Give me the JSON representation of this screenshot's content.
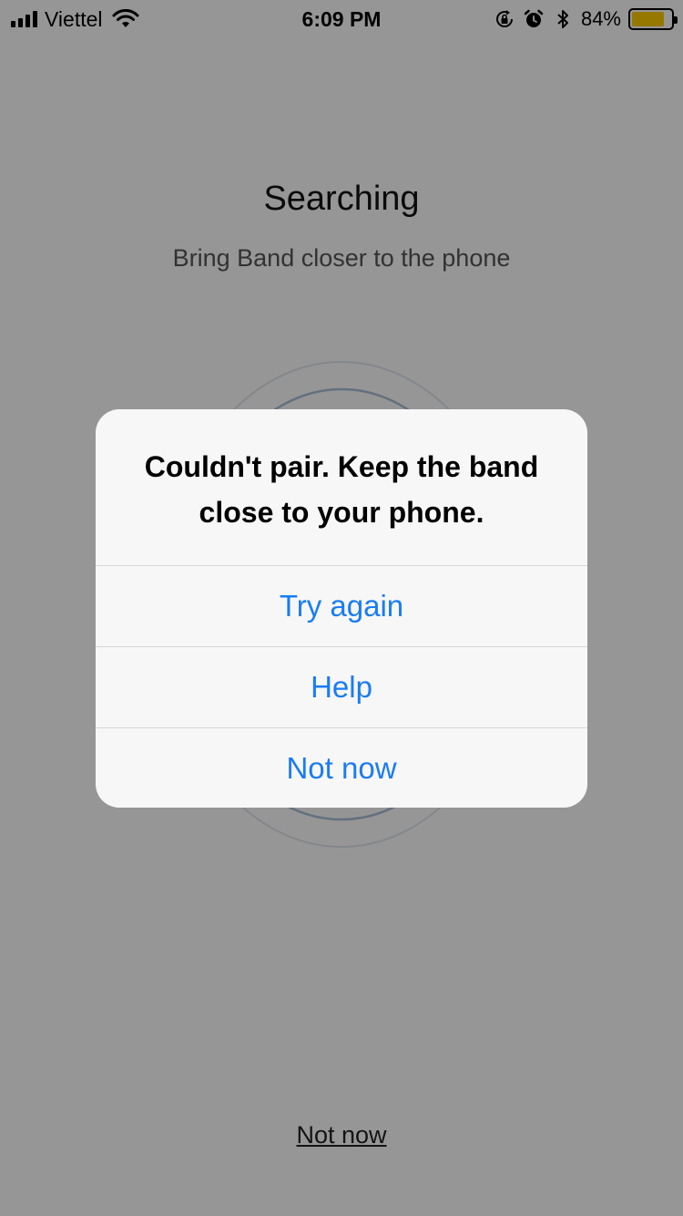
{
  "status_bar": {
    "carrier": "Viettel",
    "time": "6:09 PM",
    "battery_percent": "84%",
    "battery_level": 0.84,
    "icons": [
      "signal-icon",
      "wifi-icon",
      "rotation-lock-icon",
      "alarm-icon",
      "bluetooth-icon",
      "battery-icon"
    ]
  },
  "screen": {
    "title": "Searching",
    "subtitle": "Bring Band closer to the phone",
    "bottom_link": "Not now"
  },
  "alert": {
    "message": "Couldn't pair. Keep the band close to your phone.",
    "buttons": [
      "Try again",
      "Help",
      "Not now"
    ],
    "button_color": "#1a7cf3"
  },
  "colors": {
    "battery": "#ffcc00",
    "overlay": "rgba(0,0,0,0.41)"
  }
}
